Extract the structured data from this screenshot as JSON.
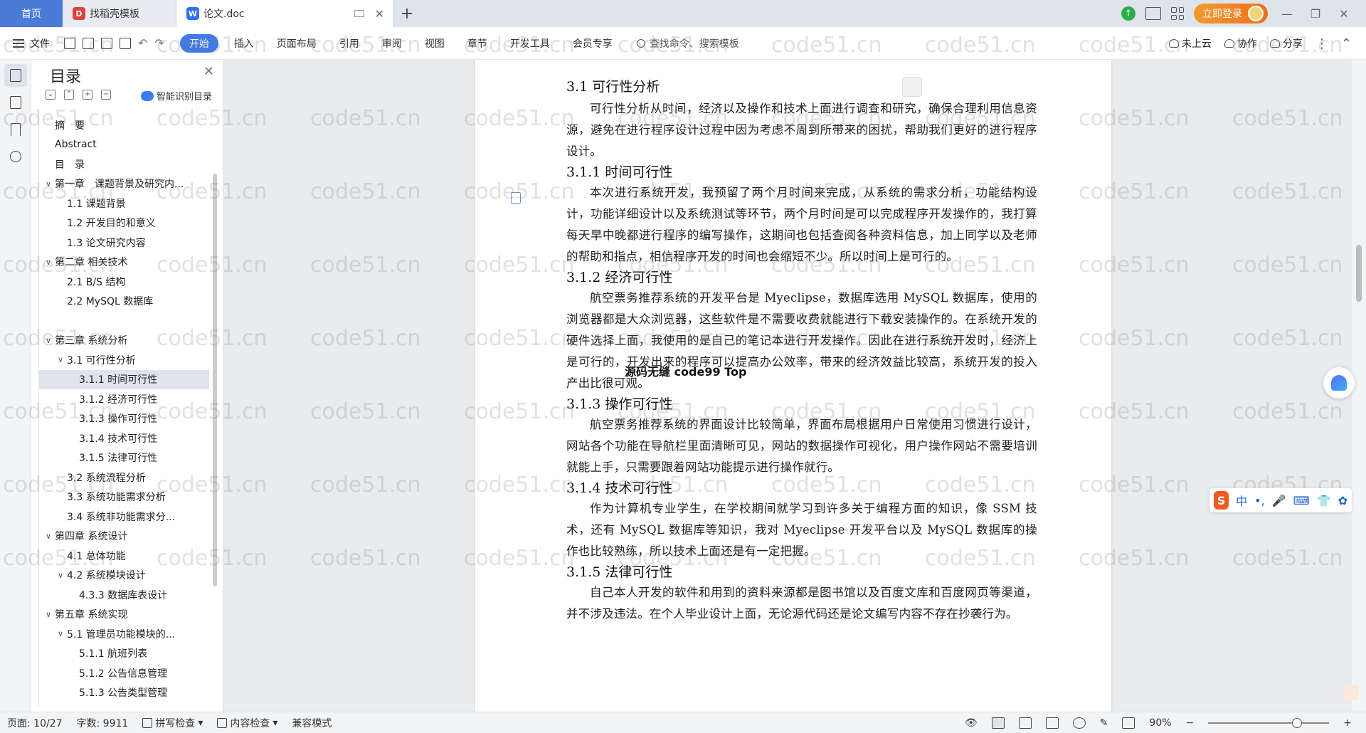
{
  "tabs": {
    "home": "首页",
    "docer": "找稻壳模板",
    "doc": "论文.doc",
    "add": "+"
  },
  "titlebar": {
    "login": "立即登录",
    "minimize": "—",
    "restore": "❐",
    "close": "✕"
  },
  "ribbon": {
    "file": "文件",
    "tabs": [
      "开始",
      "插入",
      "页面布局",
      "引用",
      "审阅",
      "视图",
      "章节",
      "开发工具",
      "会员专享"
    ],
    "search": "查找命令、搜索模板",
    "cloud": "未上云",
    "collab": "协作",
    "share": "分享"
  },
  "toc": {
    "title": "目录",
    "smart": "智能识别目录",
    "items": [
      {
        "label": "摘　要",
        "level": 0,
        "arrow": ""
      },
      {
        "label": "Abstract",
        "level": 0,
        "arrow": ""
      },
      {
        "label": "目　录",
        "level": 0,
        "arrow": ""
      },
      {
        "label": "第一章　课题背景及研究内...",
        "level": 0,
        "arrow": "∨"
      },
      {
        "label": "1.1  课题背景",
        "level": 1,
        "arrow": ""
      },
      {
        "label": "1.2  开发目的和意义",
        "level": 1,
        "arrow": ""
      },
      {
        "label": "1.3  论文研究内容",
        "level": 1,
        "arrow": ""
      },
      {
        "label": "第二章  相关技术",
        "level": 0,
        "arrow": "∨"
      },
      {
        "label": "2.1 B/S 结构",
        "level": 1,
        "arrow": ""
      },
      {
        "label": "2.2 MySQL 数据库",
        "level": 1,
        "arrow": ""
      },
      {
        "label": "",
        "level": 0,
        "arrow": ""
      },
      {
        "label": "第三章  系统分析",
        "level": 0,
        "arrow": "∨"
      },
      {
        "label": "3.1 可行性分析",
        "level": 1,
        "arrow": "∨"
      },
      {
        "label": "3.1.1 时间可行性",
        "level": 2,
        "arrow": ""
      },
      {
        "label": "3.1.2  经济可行性",
        "level": 2,
        "arrow": ""
      },
      {
        "label": "3.1.3  操作可行性",
        "level": 2,
        "arrow": ""
      },
      {
        "label": "3.1.4  技术可行性",
        "level": 2,
        "arrow": ""
      },
      {
        "label": "3.1.5  法律可行性",
        "level": 2,
        "arrow": ""
      },
      {
        "label": "3.2 系统流程分析",
        "level": 1,
        "arrow": ""
      },
      {
        "label": "3.3 系统功能需求分析",
        "level": 1,
        "arrow": ""
      },
      {
        "label": "3.4  系统非功能需求分...",
        "level": 1,
        "arrow": ""
      },
      {
        "label": "第四章  系统设计",
        "level": 0,
        "arrow": "∨"
      },
      {
        "label": "4.1  总体功能",
        "level": 1,
        "arrow": ""
      },
      {
        "label": "4.2  系统模块设计",
        "level": 1,
        "arrow": "∨"
      },
      {
        "label": "4.3.3  数据库表设计",
        "level": 2,
        "arrow": ""
      },
      {
        "label": "第五章  系统实现",
        "level": 0,
        "arrow": "∨"
      },
      {
        "label": "5.1  管理员功能模块的...",
        "level": 1,
        "arrow": "∨"
      },
      {
        "label": "5.1.1  航班列表",
        "level": 2,
        "arrow": ""
      },
      {
        "label": "5.1.2  公告信息管理",
        "level": 2,
        "arrow": ""
      },
      {
        "label": "5.1.3  公告类型管理",
        "level": 2,
        "arrow": ""
      }
    ],
    "selected_index": 13
  },
  "document": {
    "h_31": "3.1 可行性分析",
    "p_31": "可行性分析从时间，经济以及操作和技术上面进行调查和研究，确保合理利用信息资源，避免在进行程序设计过程中因为考虑不周到所带来的困扰，帮助我们更好的进行程序设计。",
    "h_311": "3.1.1 时间可行性",
    "p_311": "本次进行系统开发，我预留了两个月时间来完成，从系统的需求分析，功能结构设计，功能详细设计以及系统测试等环节，两个月时间是可以完成程序开发操作的，我打算每天早中晚都进行程序的编写操作，这期间也包括查阅各种资料信息，加上同学以及老师的帮助和指点，相信程序开发的时间也会缩短不少。所以时间上是可行的。",
    "h_312": "3.1.2  经济可行性",
    "p_312": "航空票务推荐系统的开发平台是 Myeclipse，数据库选用 MySQL 数据库，使用的浏览器都是大众浏览器，这些软件是不需要收费就能进行下载安装操作的。在系统开发的硬件选择上面，我使用的是自己的笔记本进行开发操作。因此在进行系统开发时，经济上是可行的，开发出来的程序可以提高办公效率，带来的经济效益比较高，系统开发的投入产出比很可观。",
    "h_313": "3.1.3  操作可行性",
    "p_313": "航空票务推荐系统的界面设计比较简单，界面布局根据用户日常使用习惯进行设计，网站各个功能在导航栏里面清晰可见，网站的数据操作可视化，用户操作网站不需要培训就能上手，只需要跟着网站功能提示进行操作就行。",
    "h_314": "3.1.4  技术可行性",
    "p_314": "作为计算机专业学生，在学校期间就学习到许多关于编程方面的知识，像 SSM 技术，还有 MySQL 数据库等知识，我对 Myeclipse 开发平台以及 MySQL 数据库的操作也比较熟练，所以技术上面还是有一定把握。",
    "h_315": "3.1.5  法律可行性",
    "p_315": "自己本人开发的软件和用到的资料来源都是图书馆以及百度文库和百度网页等渠道，并不涉及违法。在个人毕业设计上面，无论源代码还是论文编写内容不存在抄袭行为。",
    "overlay": "源码无缝 code99 Top"
  },
  "watermark": "code51.cn",
  "ime": {
    "label": "中"
  },
  "status": {
    "page": "页面: 10/27",
    "words": "字数: 9911",
    "spell": "拼写检查",
    "content": "内容检查",
    "compat": "兼容模式",
    "zoom": "90%",
    "zoom_minus": "−",
    "zoom_plus": "+"
  }
}
